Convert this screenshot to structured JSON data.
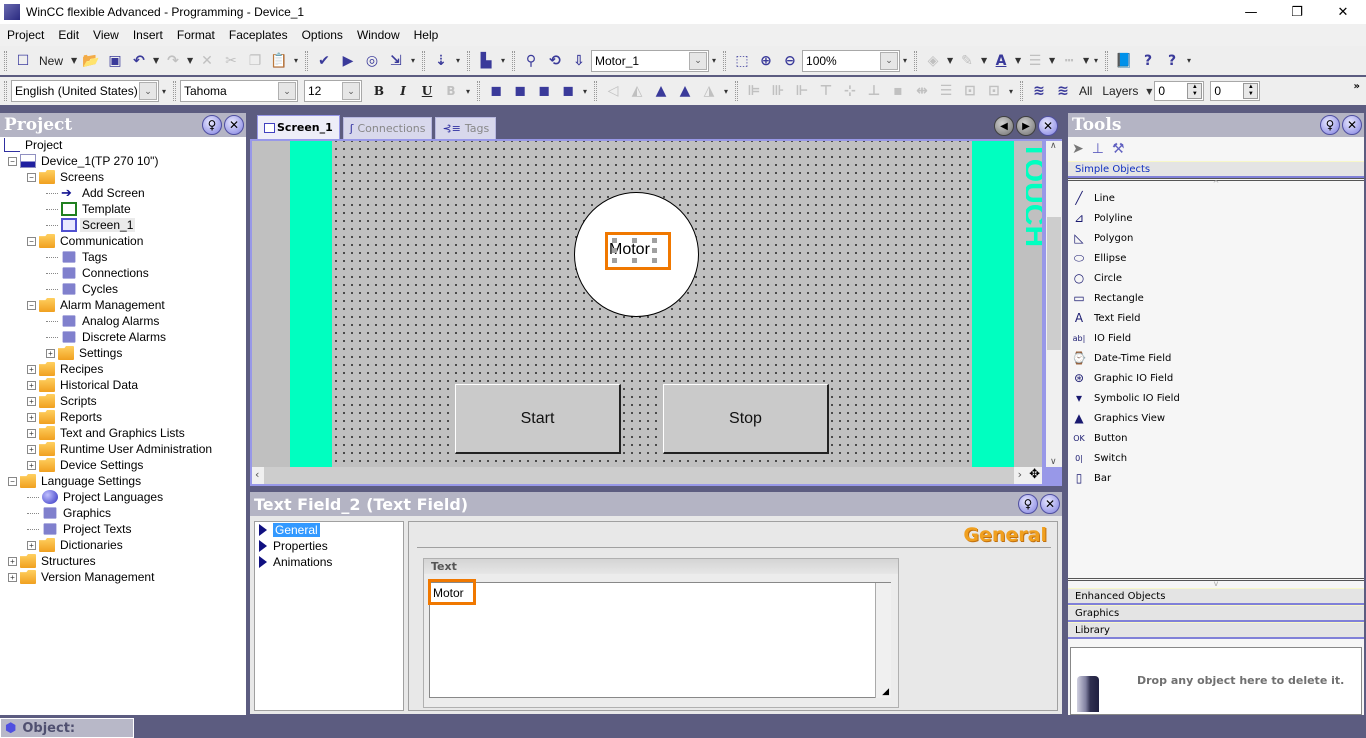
{
  "window": {
    "title": "WinCC flexible Advanced - Programming - Device_1",
    "app_icon": "CfL ES",
    "minimize": "—",
    "restore": "❐",
    "close": "✕"
  },
  "menu": [
    "Project",
    "Edit",
    "View",
    "Insert",
    "Format",
    "Faceplates",
    "Options",
    "Window",
    "Help"
  ],
  "toolbar": {
    "new_label": "New",
    "object_select": "Motor_1",
    "zoom_value": "100%",
    "language_select": "English (United States)",
    "font_select": "Tahoma",
    "font_size": "12",
    "bold": "B",
    "italic": "I",
    "underline": "U",
    "layers_all": "All",
    "layers_label": "Layers",
    "spin1": "0",
    "spin2": "0",
    "overflow": "»"
  },
  "project_panel": {
    "title": "Project",
    "tree": [
      {
        "label": "Project",
        "level": 0
      },
      {
        "label": "Device_1(TP 270 10\")",
        "level": 0
      },
      {
        "label": "Screens",
        "level": 1
      },
      {
        "label": "Add Screen",
        "level": 2
      },
      {
        "label": "Template",
        "level": 2
      },
      {
        "label": "Screen_1",
        "level": 2,
        "selected": true
      },
      {
        "label": "Communication",
        "level": 1
      },
      {
        "label": "Tags",
        "level": 2
      },
      {
        "label": "Connections",
        "level": 2
      },
      {
        "label": "Cycles",
        "level": 2
      },
      {
        "label": "Alarm Management",
        "level": 1
      },
      {
        "label": "Analog Alarms",
        "level": 2
      },
      {
        "label": "Discrete Alarms",
        "level": 2
      },
      {
        "label": "Settings",
        "level": 2
      },
      {
        "label": "Recipes",
        "level": 1
      },
      {
        "label": "Historical Data",
        "level": 1
      },
      {
        "label": "Scripts",
        "level": 1
      },
      {
        "label": "Reports",
        "level": 1
      },
      {
        "label": "Text and Graphics Lists",
        "level": 1
      },
      {
        "label": "Runtime User Administration",
        "level": 1
      },
      {
        "label": "Device Settings",
        "level": 1
      },
      {
        "label": "Language Settings",
        "level": 0
      },
      {
        "label": "Project Languages",
        "level": 1
      },
      {
        "label": "Graphics",
        "level": 1
      },
      {
        "label": "Project Texts",
        "level": 1
      },
      {
        "label": "Dictionaries",
        "level": 1
      },
      {
        "label": "Structures",
        "level": 0
      },
      {
        "label": "Version Management",
        "level": 0
      }
    ]
  },
  "editor": {
    "tabs": [
      {
        "label": "Screen_1",
        "active": true
      },
      {
        "label": "Connections",
        "active": false
      },
      {
        "label": "Tags",
        "active": false
      }
    ],
    "screen": {
      "motor_text": "Motor",
      "start_button": "Start",
      "stop_button": "Stop"
    },
    "colors": {
      "accent_cyan": "#00ffc0",
      "selection_orange": "#f07800"
    }
  },
  "properties": {
    "title": "Text Field_2 (Text Field)",
    "nav": [
      "General",
      "Properties",
      "Animations"
    ],
    "selected_nav": "General",
    "section_title": "General",
    "group_label": "Text",
    "text_value": "Motor"
  },
  "tools": {
    "title": "Tools",
    "categories": {
      "simple": "Simple Objects",
      "enhanced": "Enhanced Objects",
      "graphics": "Graphics",
      "library": "Library"
    },
    "items": [
      "Line",
      "Polyline",
      "Polygon",
      "Ellipse",
      "Circle",
      "Rectangle",
      "Text Field",
      "IO Field",
      "Date-Time Field",
      "Graphic IO Field",
      "Symbolic IO Field",
      "Graphics View",
      "Button",
      "Switch",
      "Bar"
    ],
    "trash_hint": "Drop any object here to delete it."
  },
  "status": {
    "object_label": "Object:"
  }
}
